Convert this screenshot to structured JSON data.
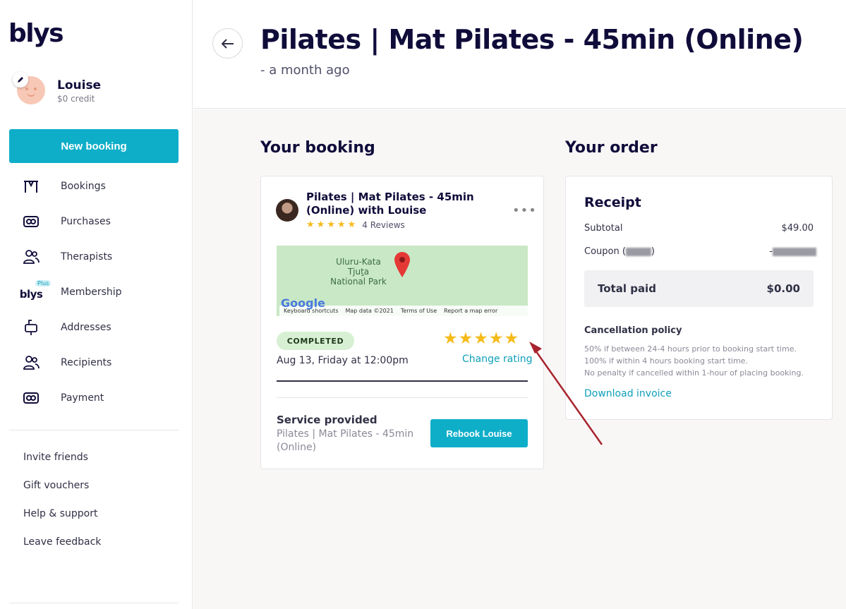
{
  "brand": {
    "logo": "blys",
    "accent": "#0eaec9",
    "star_color": "#f6bb1b"
  },
  "profile": {
    "name": "Louise",
    "credit": "$0 credit"
  },
  "sidebar": {
    "new_booking": "New booking",
    "nav": [
      {
        "label": "Bookings",
        "icon": "bookings-icon"
      },
      {
        "label": "Purchases",
        "icon": "purchases-icon"
      },
      {
        "label": "Therapists",
        "icon": "therapists-icon"
      },
      {
        "label": "Membership",
        "icon": "blys-plus-icon",
        "icon_text": "blys",
        "icon_badge": "Plus"
      },
      {
        "label": "Addresses",
        "icon": "addresses-icon"
      },
      {
        "label": "Recipients",
        "icon": "recipients-icon"
      },
      {
        "label": "Payment",
        "icon": "payment-icon"
      }
    ],
    "links": [
      "Invite friends",
      "Gift vouchers",
      "Help & support",
      "Leave feedback"
    ]
  },
  "header": {
    "title": "Pilates | Mat Pilates - 45min (Online)",
    "subtitle": "- a month ago"
  },
  "booking": {
    "section_title": "Your booking",
    "service_title": "Pilates | Mat Pilates - 45min (Online) with Louise",
    "therapist_rating": 5,
    "reviews": "4 Reviews",
    "map": {
      "place": "Uluru-Kata Tjuṯa National Park",
      "footer": [
        "Keyboard shortcuts",
        "Map data ©2021",
        "Terms of Use",
        "Report a map error"
      ],
      "google": "Google"
    },
    "status": "COMPLETED",
    "date": "Aug 13, Friday at 12:00pm",
    "user_rating": 5,
    "change_rating": "Change rating",
    "service_provided_label": "Service provided",
    "service_provided_value": "Pilates | Mat Pilates - 45min (Online)",
    "rebook_button": "Rebook Louise"
  },
  "order": {
    "section_title": "Your order",
    "receipt_title": "Receipt",
    "subtotal_label": "Subtotal",
    "subtotal_value": "$49.00",
    "coupon_label_prefix": "Coupon (",
    "coupon_label_suffix": ")",
    "coupon_value_prefix": "-",
    "total_label": "Total paid",
    "total_value": "$0.00",
    "policy_title": "Cancellation policy",
    "policy_lines": [
      "50% if between 24-4 hours prior to booking start time.",
      "100% if within 4 hours booking start time.",
      "No penalty if cancelled within 1-hour of placing booking."
    ],
    "download_invoice": "Download invoice"
  }
}
